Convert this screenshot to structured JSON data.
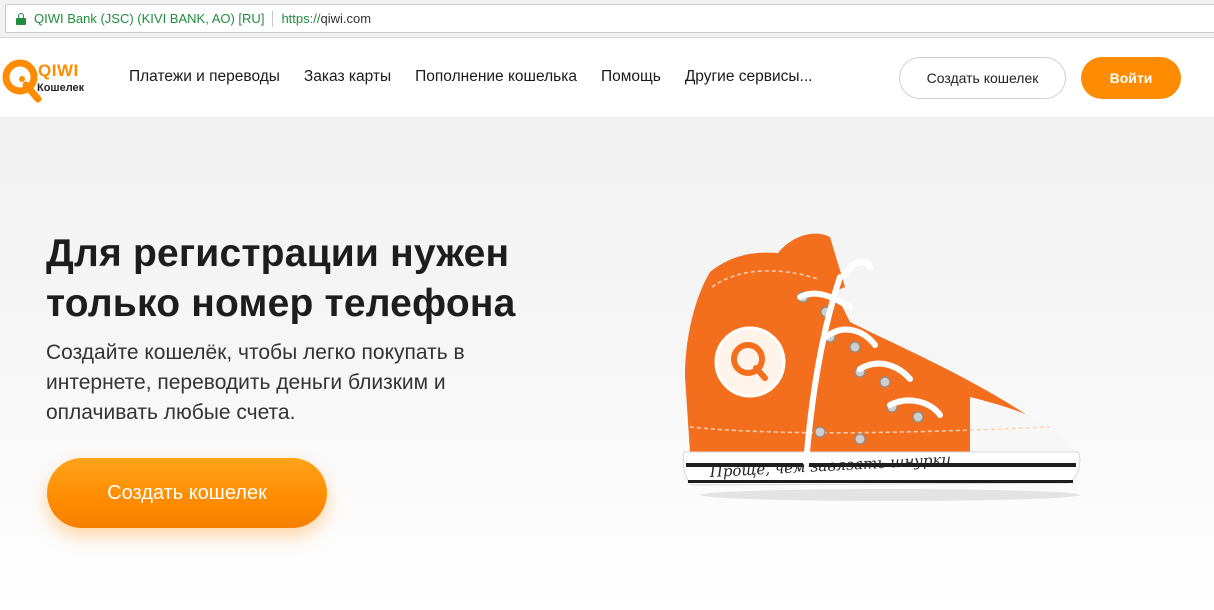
{
  "browser": {
    "cert_label": "QIWI Bank (JSC) (KIVI BANK, AO) [RU]",
    "url_scheme": "https://",
    "url_host": "qiwi.com"
  },
  "header": {
    "logo_text": "QIWI",
    "logo_sub": "Кошелек",
    "nav": [
      {
        "label": "Платежи и переводы"
      },
      {
        "label": "Заказ карты"
      },
      {
        "label": "Пополнение кошелька"
      },
      {
        "label": "Помощь"
      },
      {
        "label": "Другие сервисы..."
      }
    ],
    "create_wallet_label": "Создать кошелек",
    "login_label": "Войти"
  },
  "hero": {
    "title_line1": "Для регистрации нужен",
    "title_line2": "только номер телефона",
    "subtitle_line1": "Создайте кошелёк, чтобы легко покупать в",
    "subtitle_line2": "интернете, переводить деньги близким и",
    "subtitle_line3": "оплачивать любые счета.",
    "cta_label": "Создать кошелек",
    "shoe_caption": "Проще, чем завязать шнурки",
    "shoe_logo_icon": "qiwi-logo-icon"
  },
  "colors": {
    "brand": "#ff8c00",
    "shoe": "#f36f1e",
    "secure": "#1e8e3e"
  }
}
